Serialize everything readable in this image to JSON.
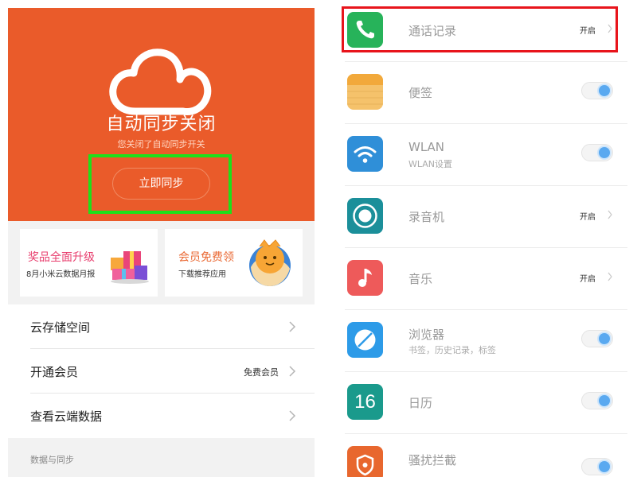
{
  "left": {
    "hero": {
      "title": "自动同步关闭",
      "subtitle": "您关闭了自动同步开关",
      "sync_button": "立即同步",
      "bg_color": "#ea5b2a",
      "highlight_color": "#1ee01a"
    },
    "promos": [
      {
        "title": "奖品全面升级",
        "desc": "8月小米云数据月报",
        "icon": "gift-box-icon"
      },
      {
        "title": "会员免费领",
        "desc": "下载推荐应用",
        "icon": "mascot-ball-icon"
      }
    ],
    "list": [
      {
        "label": "云存储空间",
        "value": ""
      },
      {
        "label": "开通会员",
        "value": "免费会员"
      },
      {
        "label": "查看云端数据",
        "value": ""
      }
    ],
    "section_title": "数据与同步"
  },
  "right": {
    "highlight_color": "#e8141b",
    "apps": [
      {
        "name": "通话记录",
        "sub": "",
        "status": "开启",
        "control": "chevron",
        "icon": "phone-icon",
        "icon_color": "#27b35a"
      },
      {
        "name": "便签",
        "sub": "",
        "status": "",
        "control": "toggle",
        "toggle_on": true,
        "icon": "notes-icon",
        "icon_color": "#f5c26b"
      },
      {
        "name": "WLAN",
        "sub": "WLAN设置",
        "status": "",
        "control": "toggle",
        "toggle_on": true,
        "icon": "wifi-icon",
        "icon_color": "#2f8fd8"
      },
      {
        "name": "录音机",
        "sub": "",
        "status": "开启",
        "control": "chevron",
        "icon": "recorder-icon",
        "icon_color": "#1b8f9a"
      },
      {
        "name": "音乐",
        "sub": "",
        "status": "开启",
        "control": "chevron",
        "icon": "music-icon",
        "icon_color": "#ee5a5a"
      },
      {
        "name": "浏览器",
        "sub": "书签，历史记录，标签",
        "status": "",
        "control": "toggle",
        "toggle_on": true,
        "icon": "browser-icon",
        "icon_color": "#2d9be8"
      },
      {
        "name": "日历",
        "sub": "",
        "status": "",
        "control": "toggle",
        "toggle_on": true,
        "icon": "calendar-icon",
        "icon_color": "#1a9a8c",
        "icon_text": "16"
      },
      {
        "name": "骚扰拦截",
        "sub": "",
        "status": "",
        "control": "toggle",
        "toggle_on": true,
        "icon": "shield-icon",
        "icon_color": "#e8672e"
      }
    ]
  }
}
